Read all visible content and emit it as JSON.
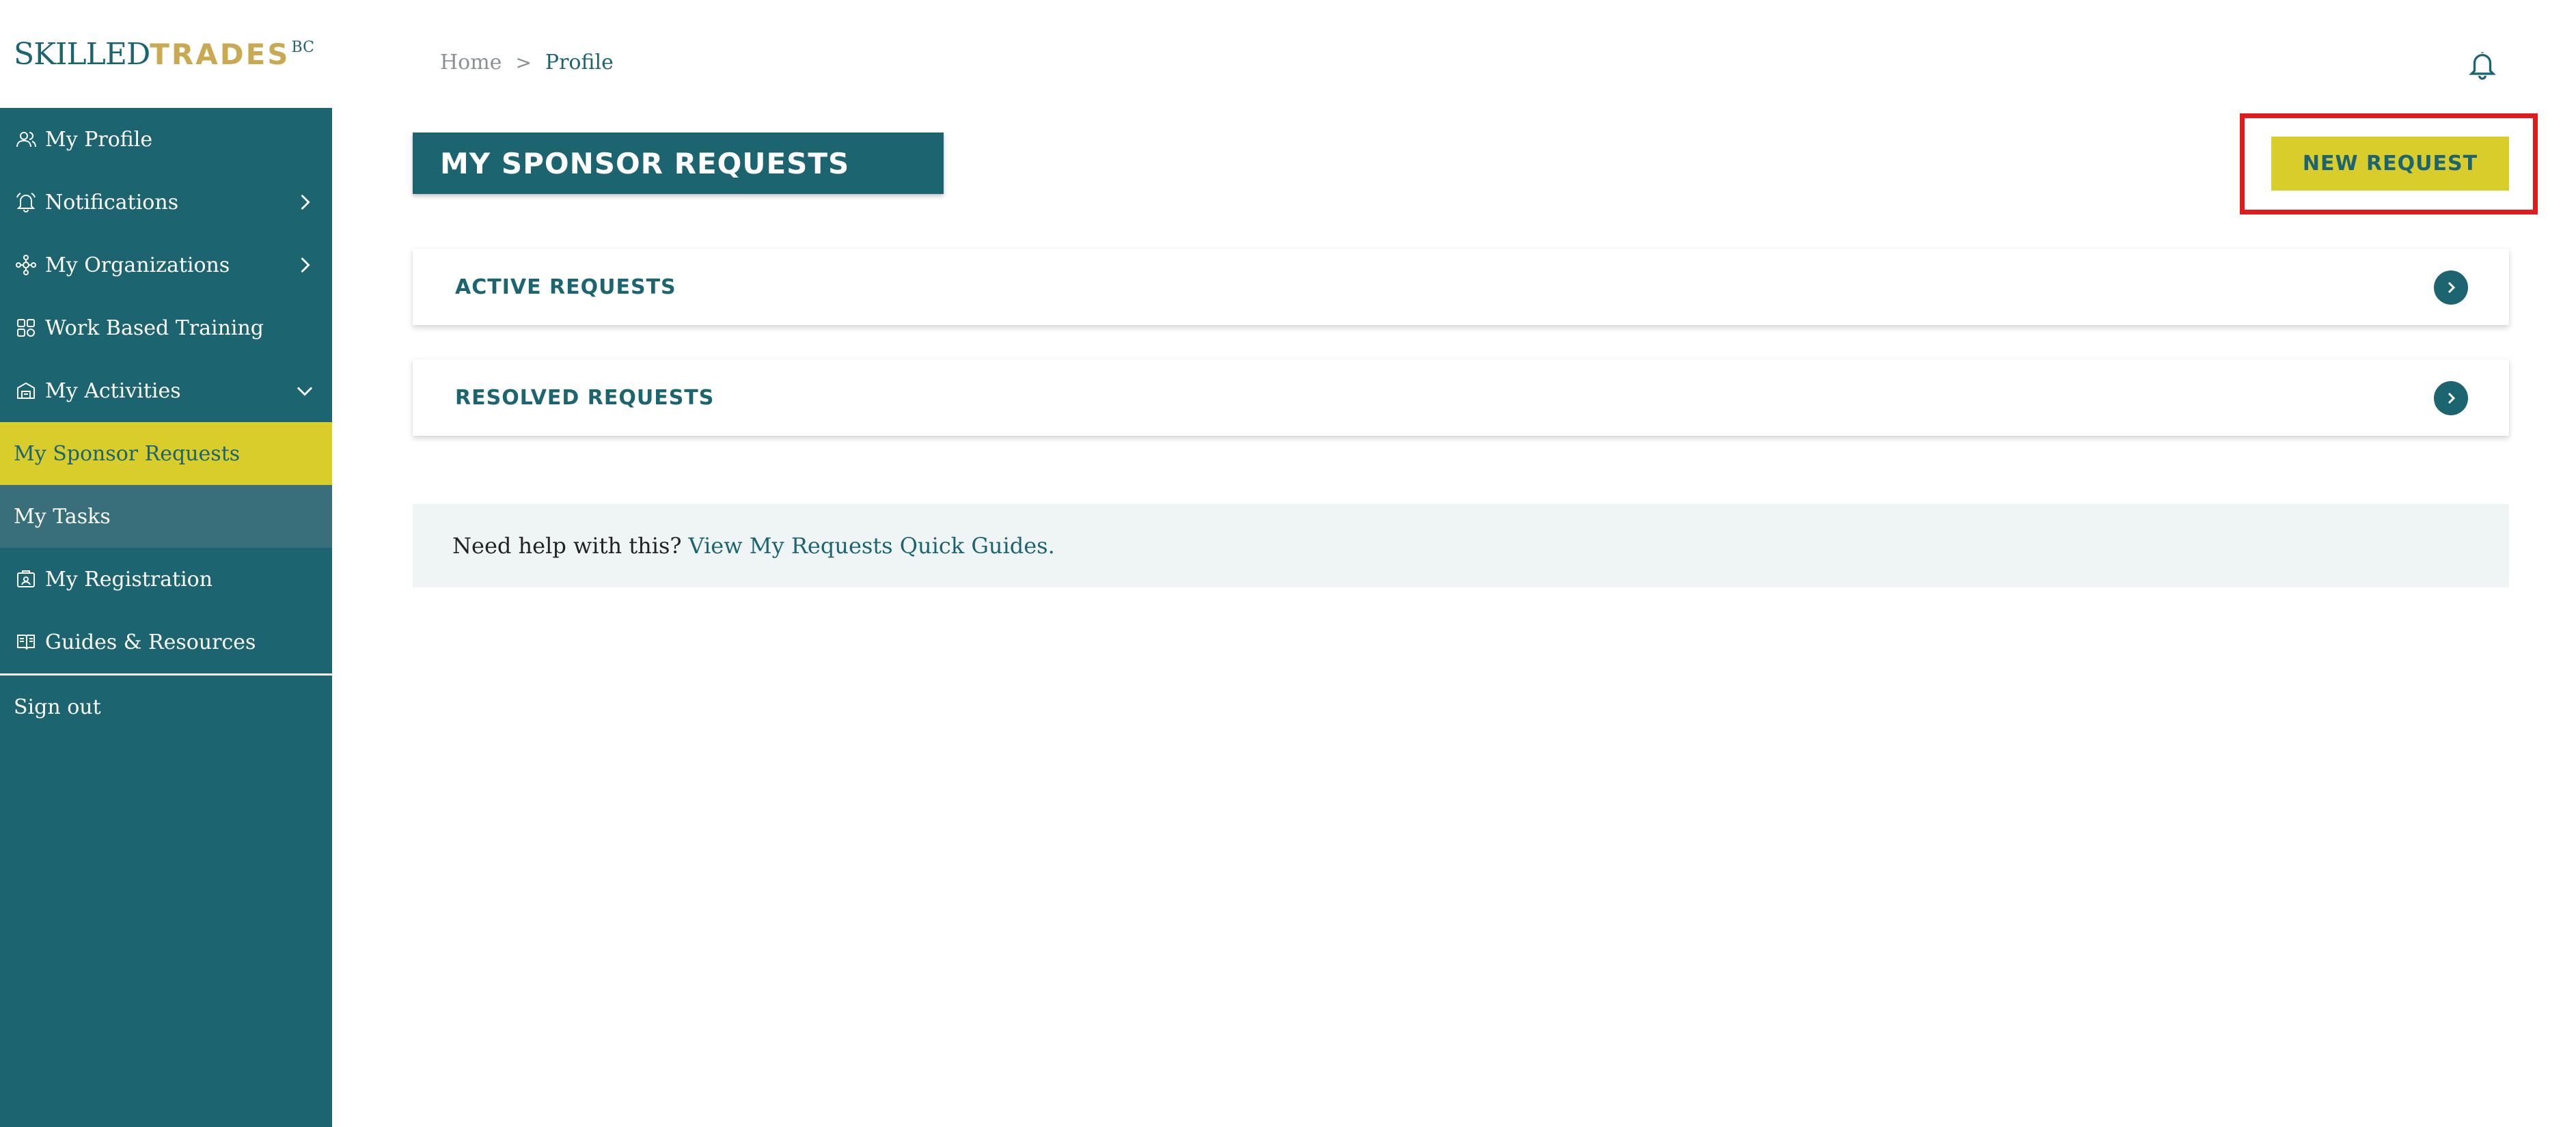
{
  "logo": {
    "part1": "SKILLED",
    "part2": "TRADES",
    "part3": "BC"
  },
  "sidebar": {
    "items": [
      {
        "label": "My Profile",
        "icon": "user-icon"
      },
      {
        "label": "Notifications",
        "icon": "bell-icon",
        "chevron": "right"
      },
      {
        "label": "My Organizations",
        "icon": "organization-icon",
        "chevron": "right"
      },
      {
        "label": "Work Based Training",
        "icon": "training-icon"
      },
      {
        "label": "My Activities",
        "icon": "activities-icon",
        "chevron": "down"
      },
      {
        "label": "My Sponsor Requests",
        "active": true
      },
      {
        "label": "My Tasks"
      },
      {
        "label": "My Registration",
        "icon": "registration-icon"
      },
      {
        "label": "Guides & Resources",
        "icon": "guides-icon"
      }
    ],
    "signout": "Sign out"
  },
  "breadcrumb": {
    "home": "Home",
    "separator": ">",
    "current": "Profile"
  },
  "page": {
    "title": "MY SPONSOR REQUESTS",
    "new_request": "NEW REQUEST",
    "panels": [
      {
        "label": "ACTIVE REQUESTS"
      },
      {
        "label": "RESOLVED REQUESTS"
      }
    ],
    "help_text": "Need help with this?",
    "help_link": "View My Requests Quick Guides."
  },
  "colors": {
    "brand_teal": "#1c6470",
    "accent_yellow": "#d8cd2b",
    "logo_gold": "#c9a951",
    "highlight_red": "#e01b1b",
    "help_bg": "#eef5f4"
  }
}
